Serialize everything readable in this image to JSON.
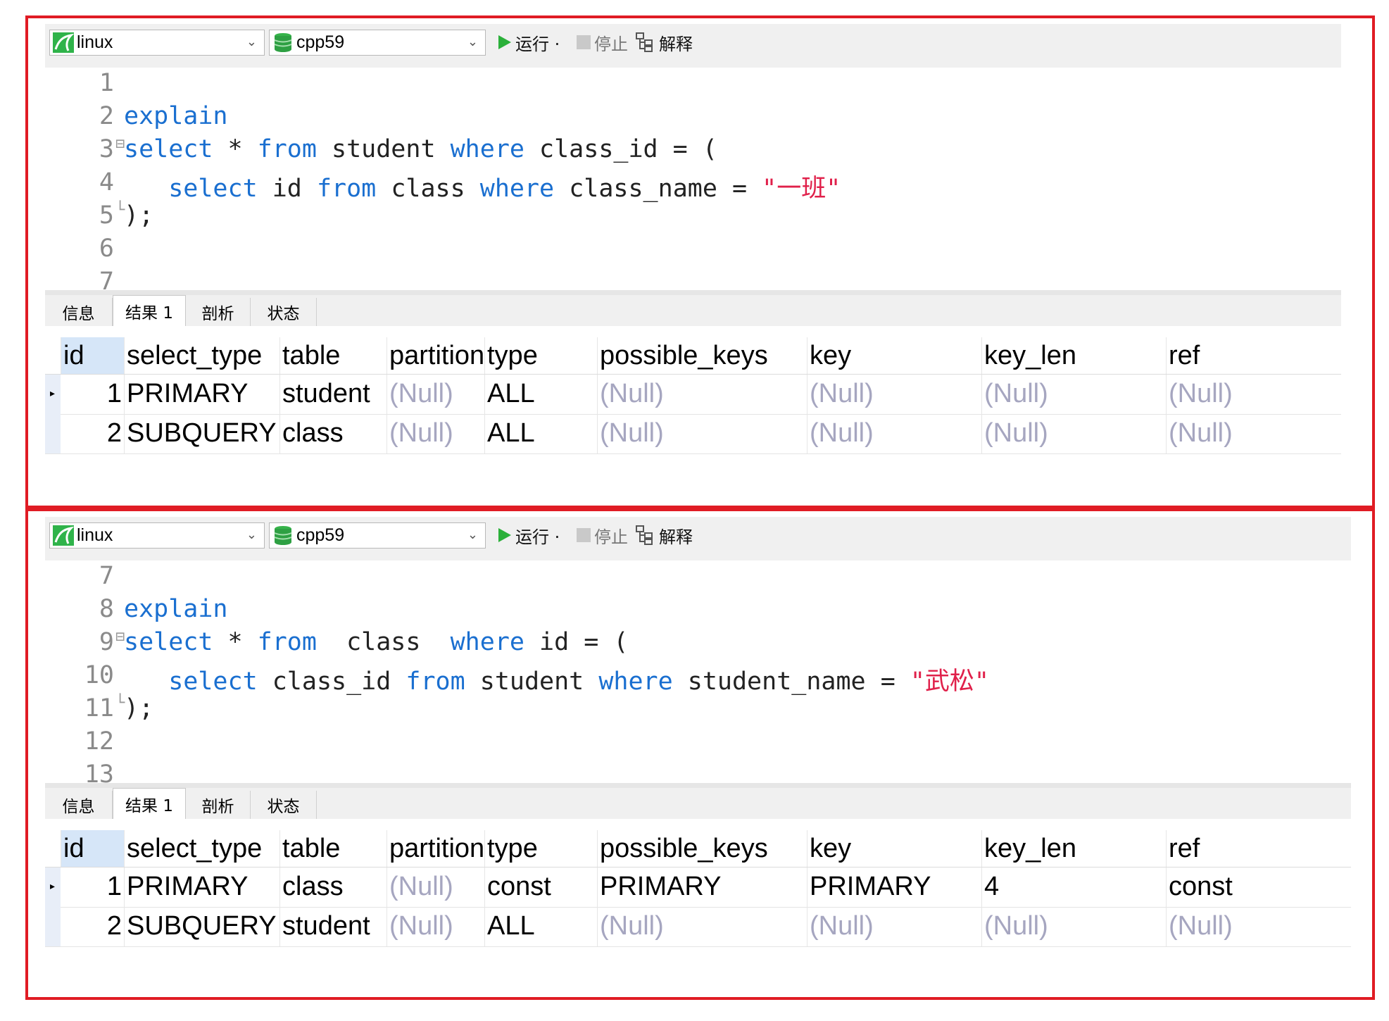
{
  "panels": [
    {
      "connection": "linux",
      "database": "cpp59",
      "toolbar": {
        "run": "运行 ·",
        "stop": "停止",
        "explain": "解释"
      },
      "editor_lines": [
        {
          "n": "1",
          "tokens": []
        },
        {
          "n": "2",
          "tokens": [
            {
              "t": "explain",
              "c": "kw"
            }
          ]
        },
        {
          "n": "3",
          "fold": "⊟",
          "tokens": [
            {
              "t": "select",
              "c": "kw"
            },
            {
              "t": " * ",
              "c": "plain"
            },
            {
              "t": "from",
              "c": "kw"
            },
            {
              "t": " student ",
              "c": "plain"
            },
            {
              "t": "where",
              "c": "kw"
            },
            {
              "t": " class_id = (",
              "c": "plain"
            }
          ]
        },
        {
          "n": "4",
          "tokens": [
            {
              "t": "   ",
              "c": "plain"
            },
            {
              "t": "select",
              "c": "kw"
            },
            {
              "t": " id ",
              "c": "plain"
            },
            {
              "t": "from",
              "c": "kw"
            },
            {
              "t": " class ",
              "c": "plain"
            },
            {
              "t": "where",
              "c": "kw"
            },
            {
              "t": " class_name = ",
              "c": "plain"
            },
            {
              "t": "\"一班\"",
              "c": "str"
            }
          ]
        },
        {
          "n": "5",
          "fold": "└",
          "tokens": [
            {
              "t": ");",
              "c": "plain"
            }
          ]
        },
        {
          "n": "6",
          "tokens": []
        },
        {
          "n": "7",
          "tokens": []
        }
      ],
      "tabs": [
        "信息",
        "结果 1",
        "剖析",
        "状态"
      ],
      "columns": [
        "id",
        "select_type",
        "table",
        "partitions",
        "type",
        "possible_keys",
        "key",
        "key_len",
        "ref"
      ],
      "rows": [
        [
          "1",
          "PRIMARY",
          "student",
          "(Null)",
          "ALL",
          "(Null)",
          "(Null)",
          "(Null)",
          "(Null)"
        ],
        [
          "2",
          "SUBQUERY",
          "class",
          "(Null)",
          "ALL",
          "(Null)",
          "(Null)",
          "(Null)",
          "(Null)"
        ]
      ]
    },
    {
      "connection": "linux",
      "database": "cpp59",
      "toolbar": {
        "run": "运行 ·",
        "stop": "停止",
        "explain": "解释"
      },
      "editor_lines": [
        {
          "n": "7",
          "tokens": []
        },
        {
          "n": "8",
          "tokens": [
            {
              "t": "explain",
              "c": "kw"
            }
          ]
        },
        {
          "n": "9",
          "fold": "⊟",
          "tokens": [
            {
              "t": "select",
              "c": "kw"
            },
            {
              "t": " * ",
              "c": "plain"
            },
            {
              "t": "from",
              "c": "kw"
            },
            {
              "t": "  class  ",
              "c": "plain"
            },
            {
              "t": "where",
              "c": "kw"
            },
            {
              "t": " id = (",
              "c": "plain"
            }
          ]
        },
        {
          "n": "10",
          "tokens": [
            {
              "t": "   ",
              "c": "plain"
            },
            {
              "t": "select",
              "c": "kw"
            },
            {
              "t": " class_id ",
              "c": "plain"
            },
            {
              "t": "from",
              "c": "kw"
            },
            {
              "t": " student ",
              "c": "plain"
            },
            {
              "t": "where",
              "c": "kw"
            },
            {
              "t": " student_name = ",
              "c": "plain"
            },
            {
              "t": "\"武松\"",
              "c": "str"
            }
          ]
        },
        {
          "n": "11",
          "fold": "└",
          "tokens": [
            {
              "t": ");",
              "c": "plain"
            }
          ]
        },
        {
          "n": "12",
          "tokens": []
        },
        {
          "n": "13",
          "tokens": []
        }
      ],
      "tabs": [
        "信息",
        "结果 1",
        "剖析",
        "状态"
      ],
      "columns": [
        "id",
        "select_type",
        "table",
        "partitions",
        "type",
        "possible_keys",
        "key",
        "key_len",
        "ref"
      ],
      "rows": [
        [
          "1",
          "PRIMARY",
          "class",
          "(Null)",
          "const",
          "PRIMARY",
          "PRIMARY",
          "4",
          "const"
        ],
        [
          "2",
          "SUBQUERY",
          "student",
          "(Null)",
          "ALL",
          "(Null)",
          "(Null)",
          "(Null)",
          "(Null)"
        ]
      ]
    }
  ]
}
